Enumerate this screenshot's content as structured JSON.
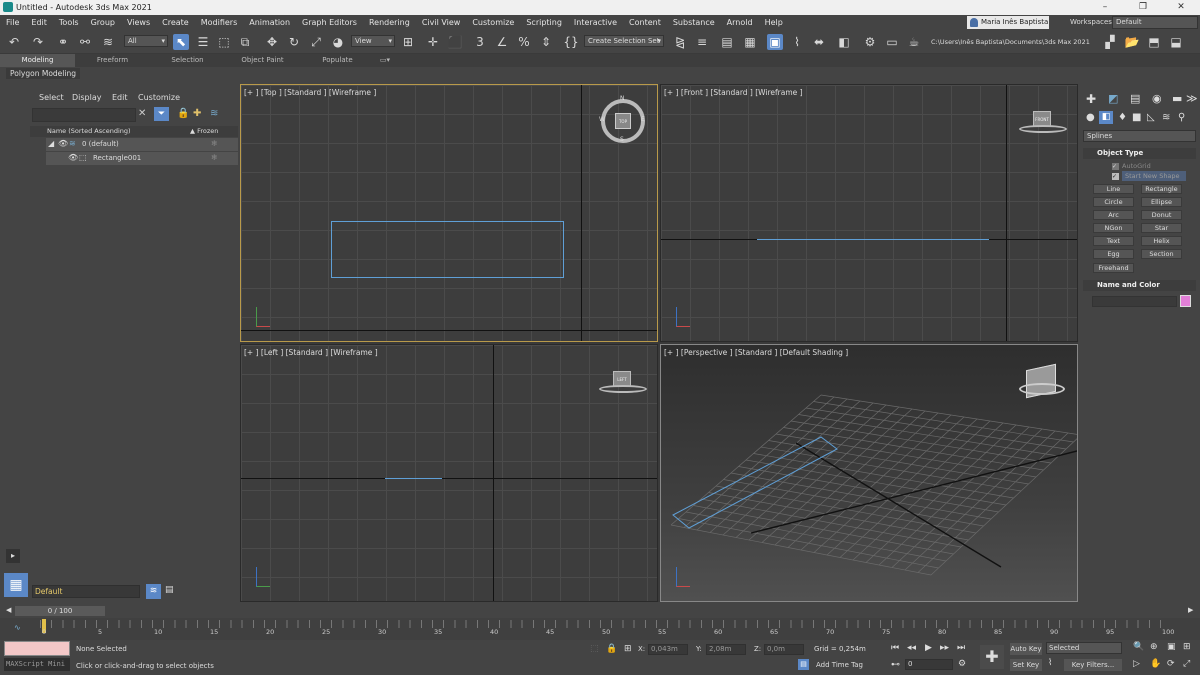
{
  "app": {
    "title": "Untitled - Autodesk 3ds Max 2021",
    "window_controls": [
      "–",
      "❐",
      "✕"
    ]
  },
  "menu": [
    "File",
    "Edit",
    "Tools",
    "Group",
    "Views",
    "Create",
    "Modifiers",
    "Animation",
    "Graph Editors",
    "Rendering",
    "Civil View",
    "Customize",
    "Scripting",
    "Interactive",
    "Content",
    "Substance",
    "Arnold",
    "Help"
  ],
  "user": "Maria Inês Baptista",
  "workspaces_label": "Workspaces:",
  "workspace": "Default",
  "toolbar": {
    "filter": "All",
    "refcoord": "View",
    "selset": "Create Selection Set",
    "path": "C:\\Users\\Inês Baptista\\Documents\\3ds Max 2021"
  },
  "ribbon_tabs": [
    "Modeling",
    "Freeform",
    "Selection",
    "Object Paint",
    "Populate"
  ],
  "ribbon_sub": "Polygon Modeling",
  "scene": {
    "menu": [
      "Select",
      "Display",
      "Edit",
      "Customize"
    ],
    "col_name": "Name (Sorted Ascending)",
    "col_frozen": "▲ Frozen",
    "rows": [
      {
        "name": "0 (default)"
      },
      {
        "name": "Rectangle001"
      }
    ],
    "layer": "Default"
  },
  "viewports": {
    "top": "[+ ] [Top ] [Standard ] [Wireframe ]",
    "front": "[+ ] [Front ] [Standard ] [Wireframe ]",
    "left": "[+ ] [Left ] [Standard ] [Wireframe ]",
    "persp": "[+ ] [Perspective ] [Standard ] [Default Shading ]"
  },
  "viewcube": {
    "top": "TOP",
    "front": "FRONT",
    "left": "LEFT",
    "n": "N",
    "s": "S",
    "w": "W",
    "e": "E"
  },
  "cmd": {
    "dropdown": "Splines",
    "object_type": "Object Type",
    "autogrid": "AutoGrid",
    "start_new": "Start New Shape",
    "buttons": [
      "Line",
      "Rectangle",
      "Circle",
      "Ellipse",
      "Arc",
      "Donut",
      "NGon",
      "Star",
      "Text",
      "Helix",
      "Egg",
      "Section",
      "Freehand"
    ],
    "name_color": "Name and Color",
    "swatch": "#e27fd7"
  },
  "time": {
    "slider": "0 / 100",
    "ticks": [
      "0",
      "5",
      "10",
      "15",
      "20",
      "25",
      "30",
      "35",
      "40",
      "45",
      "50",
      "55",
      "60",
      "65",
      "70",
      "75",
      "80",
      "85",
      "90",
      "95",
      "100"
    ]
  },
  "status": {
    "maxscript": "MAXScript Mini",
    "selected": "None Selected",
    "prompt": "Click or click-and-drag to select objects",
    "x": "0,043m",
    "y": "2,08m",
    "z": "0,0m",
    "grid": "Grid = 0,254m",
    "addtag": "Add Time Tag",
    "frame": "0",
    "autokey": "Auto Key",
    "setkey": "Set Key",
    "keysel": "Selected",
    "keyfilters": "Key Filters..."
  }
}
